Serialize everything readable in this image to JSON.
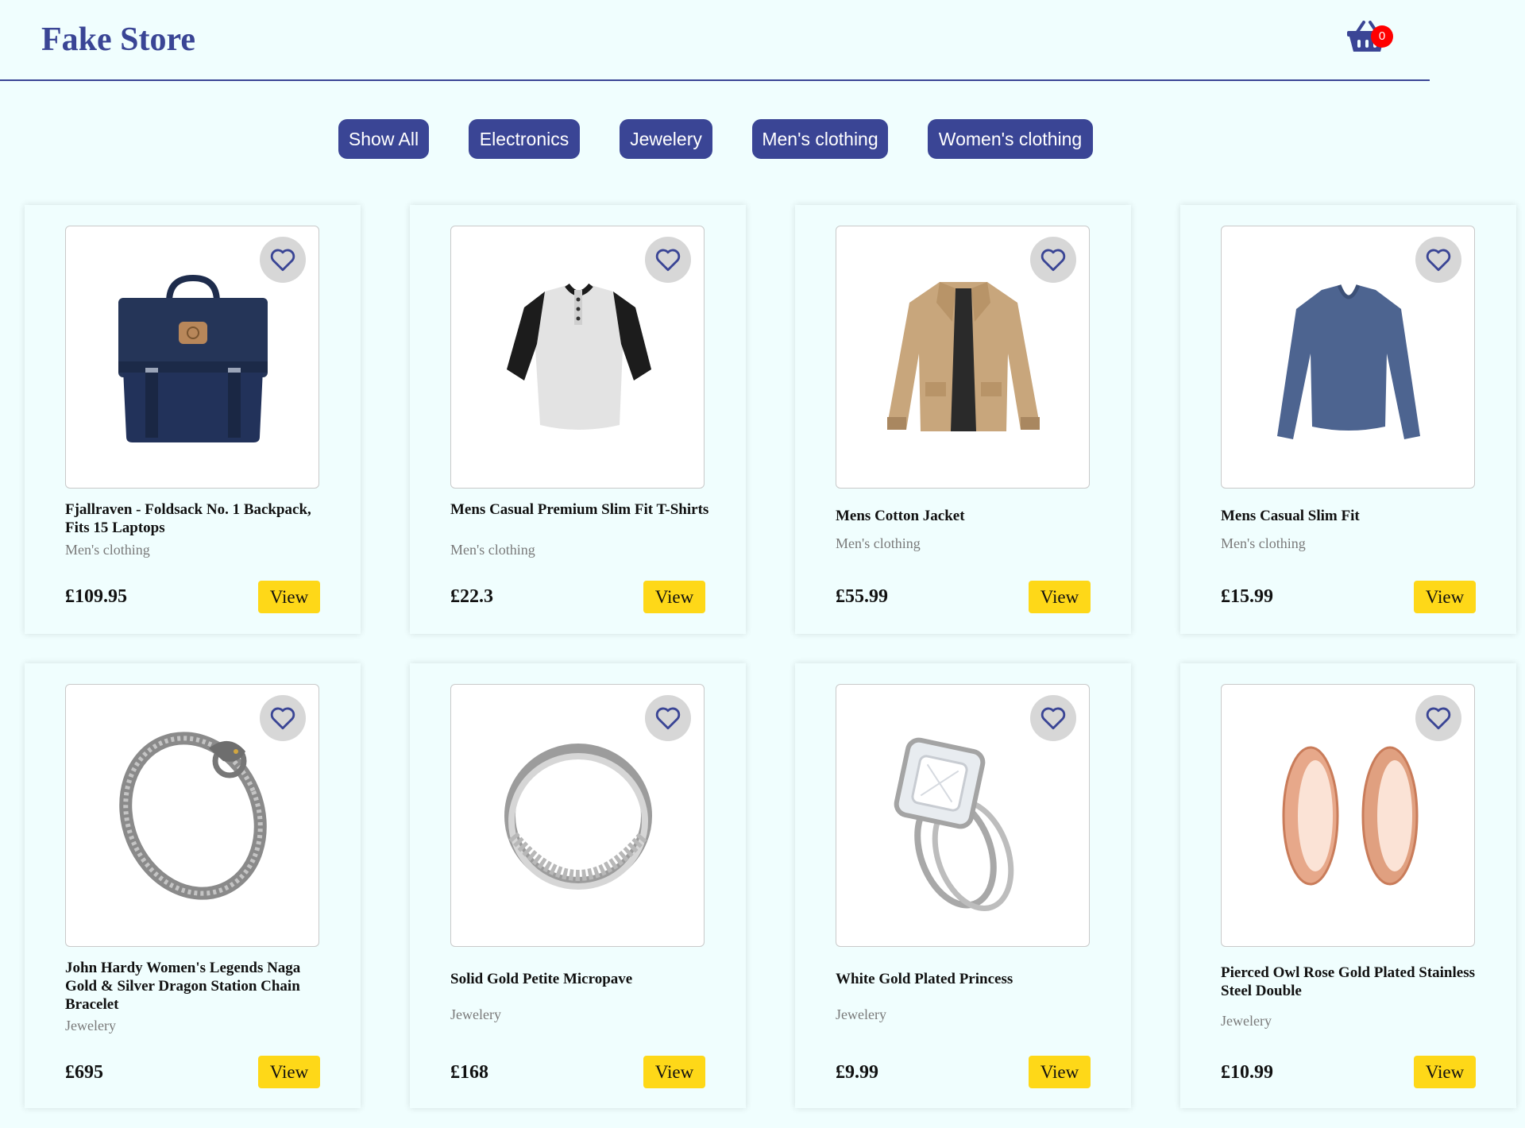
{
  "header": {
    "brand": "Fake Store",
    "cart_count": "0"
  },
  "filters": [
    "Show All",
    "Electronics",
    "Jewelery",
    "Men's clothing",
    "Women's clothing"
  ],
  "products": [
    {
      "title": "Fjallraven - Foldsack No. 1 Backpack, Fits 15 Laptops",
      "category": "Men's clothing",
      "price": "£109.95",
      "view": "View",
      "icon": "backpack-image"
    },
    {
      "title": "Mens Casual Premium Slim Fit T-Shirts",
      "category": "Men's clothing",
      "price": "£22.3",
      "view": "View",
      "icon": "tshirt-image"
    },
    {
      "title": "Mens Cotton Jacket",
      "category": "Men's clothing",
      "price": "£55.99",
      "view": "View",
      "icon": "jacket-image"
    },
    {
      "title": "Mens Casual Slim Fit",
      "category": "Men's clothing",
      "price": "£15.99",
      "view": "View",
      "icon": "longsleeve-image"
    },
    {
      "title": "John Hardy Women's Legends Naga Gold & Silver Dragon Station Chain Bracelet",
      "category": "Jewelery",
      "price": "£695",
      "view": "View",
      "icon": "bracelet-image"
    },
    {
      "title": "Solid Gold Petite Micropave",
      "category": "Jewelery",
      "price": "£168",
      "view": "View",
      "icon": "ring-image"
    },
    {
      "title": "White Gold Plated Princess",
      "category": "Jewelery",
      "price": "£9.99",
      "view": "View",
      "icon": "diamond-ring-image"
    },
    {
      "title": "Pierced Owl Rose Gold Plated Stainless Steel Double",
      "category": "Jewelery",
      "price": "£10.99",
      "view": "View",
      "icon": "plugs-image"
    }
  ],
  "colors": {
    "background": "#f0fefe",
    "brand": "#3a4595",
    "view_button": "#fed818",
    "badge": "#ff0000"
  }
}
